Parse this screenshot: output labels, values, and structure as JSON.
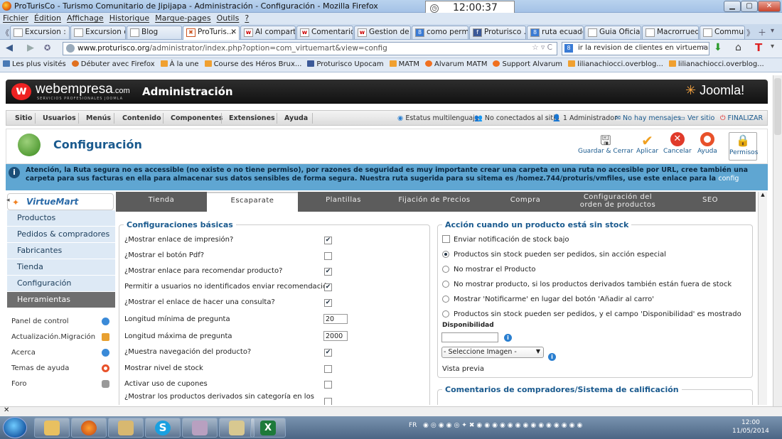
{
  "window": {
    "title": "ProTurisCo - Turismo Comunitario de Jipijapa - Administración - Configuración - Mozilla Firefox",
    "clock": "12:00:37"
  },
  "menubar": [
    "Fichier",
    "Édition",
    "Affichage",
    "Historique",
    "Marque-pages",
    "Outils",
    "?"
  ],
  "tabs": [
    "Excursion : ...",
    "Excursion d...",
    "Blog",
    "ProTuris...",
    "Al comparti...",
    "Comentario...",
    "Gestion de ...",
    "como perm...",
    "Proturisco ...",
    "ruta ecuado...",
    "Guia Oficial ...",
    "Macrorrued...",
    "Communi"
  ],
  "url": {
    "domain": "www.proturisco.org",
    "path": "/administrator/index.php?option=com_virtuemart&view=config",
    "search": "ir la revision de clientes en virtuemart"
  },
  "bookmarks": [
    "Les plus visités",
    "Débuter avec Firefox",
    "À la une",
    "Course des Héros Brux...",
    "Proturisco Upocam",
    "MATM",
    "Alvarum MATM",
    "Support Alvarum",
    "lilianachiocci.overblog...",
    "lilianachiocci.overblog..."
  ],
  "header": {
    "brand": "webempresa",
    "brand_suffix": ".com",
    "brand_sub": "SERVICIOS PROFESIONALES JOOMLA",
    "admin": "Administración",
    "joomla": "Joomla!"
  },
  "jmenu": {
    "items": [
      "Sitio",
      "Usuarios",
      "Menús",
      "Contenido",
      "Componentes",
      "Extensiones",
      "Ayuda"
    ],
    "status": [
      "Estatus multilenguaje",
      "No conectados al sitio",
      "1 Administrador",
      "No hay mensajes",
      "Ver sitio",
      "FINALIZAR"
    ]
  },
  "toolbar": {
    "title": "Configuración",
    "buttons": [
      "Guardar & Cerrar",
      "Aplicar",
      "Cancelar",
      "Ayuda",
      "Permisos"
    ]
  },
  "notice": {
    "text": "Atención, la Ruta segura no es accessible (no existe o no tiene permiso), por razones de seguridad es muy importante crear una carpeta en una ruta no accesible por URL, cree también una carpeta para sus facturas en ella para almacenar sus datos sensibles de forma segura. Nuestra ruta sugerida para su sitema es /homez.744/proturis/vmfiles, use este enlace para la",
    "link": "config"
  },
  "vm_logo": "VirtueMart",
  "sidenav": [
    "Productos",
    "Pedidos & compradores",
    "Fabricantes",
    "Tienda",
    "Configuración",
    "Herramientas"
  ],
  "sidelist": [
    "Panel de control",
    "Actualización.Migración",
    "Acerca",
    "Temas de ayuda",
    "Foro"
  ],
  "vmtabs": [
    "Tienda",
    "Escaparate",
    "Plantillas",
    "Fijación de Precios",
    "Compra",
    "Configuración del orden de productos",
    "SEO"
  ],
  "basic": {
    "legend": "Configuraciones básicas",
    "rows": [
      {
        "label": "¿Mostrar enlace de impresión?",
        "checked": true
      },
      {
        "label": "¿Mostrar el botón Pdf?",
        "checked": false
      },
      {
        "label": "¿Mostrar enlace para recomendar producto?",
        "checked": true
      },
      {
        "label": "Permitir a usuarios no identificados enviar recomendación",
        "checked": true
      },
      {
        "label": "¿Mostrar el enlace de hacer una consulta?",
        "checked": true
      },
      {
        "label": "Longitud mínima de pregunta",
        "value": "20"
      },
      {
        "label": "Longitud máxima de pregunta",
        "value": "2000"
      },
      {
        "label": "¿Muestra navegación del producto?",
        "checked": true
      },
      {
        "label": "Mostrar nivel de stock",
        "checked": false
      },
      {
        "label": "Activar uso de cupones",
        "checked": false
      },
      {
        "label": "¿Mostrar los productos derivados sin categoría en los",
        "checked": false
      }
    ]
  },
  "stock": {
    "legend": "Acción cuando un producto está sin stock",
    "notify": "Enviar notificación de stock bajo",
    "options": [
      {
        "label": "Productos sin stock pueden ser pedidos, sin acción especial",
        "selected": true
      },
      {
        "label": "No mostrar el Producto",
        "selected": false
      },
      {
        "label": "No mostrar producto, si los productos derivados también están fuera de stock",
        "selected": false
      },
      {
        "label": "Mostrar 'Notificarme' en lugar del botón 'Añadir al carro'",
        "selected": false
      },
      {
        "label": "Productos sin stock pueden ser pedidos, y el campo 'Disponibilidad' es mostrado",
        "selected": false
      }
    ],
    "availability_label": "Disponibilidad",
    "image_select": "- Seleccione Imagen -",
    "preview": "Vista previa"
  },
  "reviews": {
    "legend": "Comentarios de compradores/Sistema de calificación"
  },
  "taskbar": {
    "lang": "FR",
    "time": "12:00",
    "date": "11/05/2014"
  }
}
